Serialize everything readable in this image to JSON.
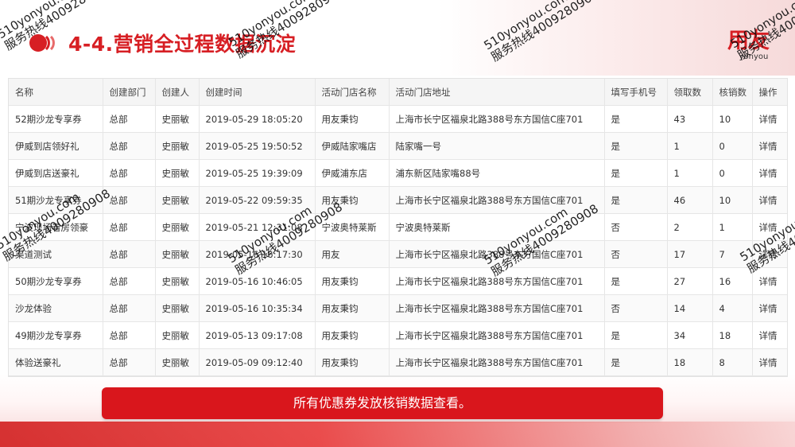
{
  "header": {
    "title": "4-4.营销全过程数据沉淀",
    "brand_cn": "用友",
    "brand_en": "yonyou"
  },
  "colors": {
    "accent": "#d71f24",
    "banner": "#d9161c"
  },
  "table": {
    "columns": [
      "名称",
      "创建部门",
      "创建人",
      "创建时间",
      "活动门店名称",
      "活动门店地址",
      "填写手机号",
      "领取数",
      "核销数",
      "操作"
    ],
    "rows": [
      [
        "52期沙龙专享券",
        "总部",
        "史丽敏",
        "2019-05-29 18:05:20",
        "用友秉钧",
        "上海市长宁区福泉北路388号东方国信C座701",
        "是",
        "43",
        "10",
        "详情"
      ],
      [
        "伊威到店领好礼",
        "总部",
        "史丽敏",
        "2019-05-25 19:50:52",
        "伊威陆家嘴店",
        "陆家嘴一号",
        "是",
        "1",
        "0",
        "详情"
      ],
      [
        "伊威到店送豪礼",
        "总部",
        "史丽敏",
        "2019-05-25 19:39:09",
        "伊威浦东店",
        "浦东新区陆家嘴88号",
        "是",
        "1",
        "0",
        "详情"
      ],
      [
        "51期沙龙专享券",
        "总部",
        "史丽敏",
        "2019-05-22 09:59:35",
        "用友秉钧",
        "上海市长宁区福泉北路388号东方国信C座701",
        "是",
        "46",
        "10",
        "详情"
      ],
      [
        "宁波现场看房领豪",
        "总部",
        "史丽敏",
        "2019-05-21 12:31:08",
        "宁波奥特莱斯",
        "宁波奥特莱斯",
        "否",
        "2",
        "1",
        "详情"
      ],
      [
        "渠道测试",
        "总部",
        "史丽敏",
        "2019-05-16 16:17:30",
        "用友",
        "上海市长宁区福泉北路388号东方国信C座701",
        "否",
        "17",
        "7",
        "详情"
      ],
      [
        "50期沙龙专享券",
        "总部",
        "史丽敏",
        "2019-05-16 10:46:05",
        "用友秉钧",
        "上海市长宁区福泉北路388号东方国信C座701",
        "是",
        "27",
        "16",
        "详情"
      ],
      [
        "沙龙体验",
        "总部",
        "史丽敏",
        "2019-05-16 10:35:34",
        "用友秉钧",
        "上海市长宁区福泉北路388号东方国信C座701",
        "否",
        "14",
        "4",
        "详情"
      ],
      [
        "49期沙龙专享券",
        "总部",
        "史丽敏",
        "2019-05-13 09:17:08",
        "用友秉钧",
        "上海市长宁区福泉北路388号东方国信C座701",
        "是",
        "34",
        "18",
        "详情"
      ],
      [
        "体验送豪礼",
        "总部",
        "史丽敏",
        "2019-05-09 09:12:40",
        "用友秉钧",
        "上海市长宁区福泉北路388号东方国信C座701",
        "是",
        "18",
        "8",
        "详情"
      ]
    ]
  },
  "banner": {
    "text": "所有优惠券发放核销数据查看。"
  },
  "watermark": {
    "line1": "510yonyou.com",
    "line2": "服务热线4009280908"
  }
}
